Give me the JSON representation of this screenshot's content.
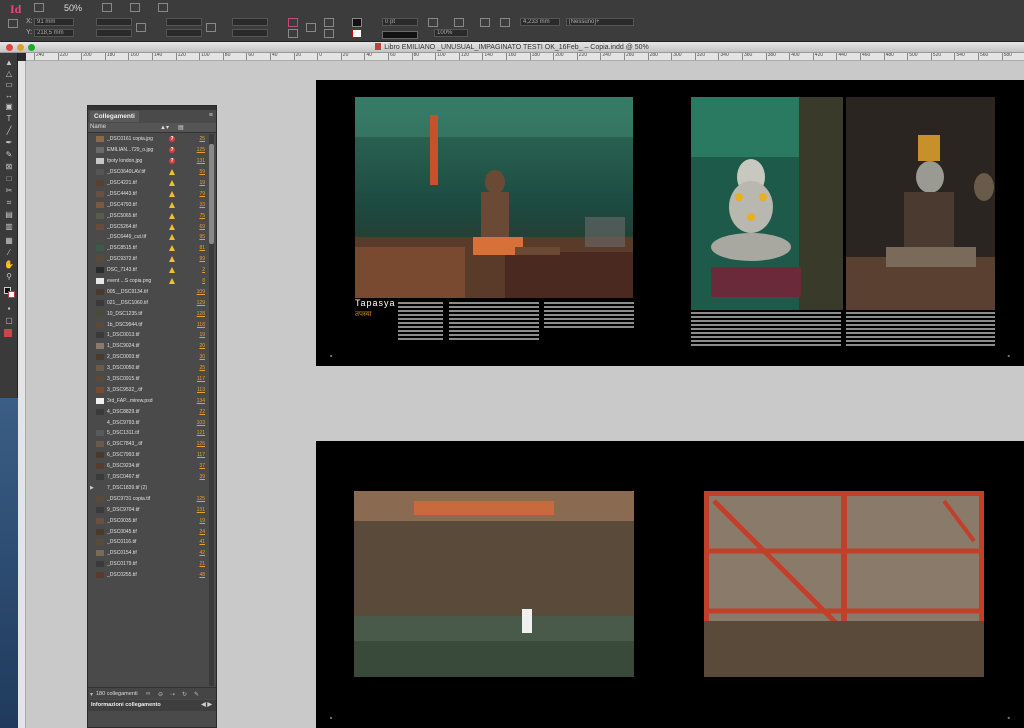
{
  "app": {
    "logo": "Id",
    "zoom": "50%",
    "window_title": "Libro EMILIANO _UNUSUAL_IMPAGINATO TESTI OK_16Feb_ – Copia.indd @ 50%"
  },
  "control_bar": {
    "x_field": "91 mm",
    "y_field": "218,5 mm",
    "stroke_weight": "0 pt",
    "opacity": "100%",
    "gap": "4,233 mm",
    "style_select": "[Nessuno]+"
  },
  "ruler_h_ticks": [
    "240",
    "220",
    "200",
    "180",
    "160",
    "140",
    "120",
    "100",
    "80",
    "60",
    "40",
    "20",
    "0",
    "20",
    "40",
    "60",
    "80",
    "100",
    "120",
    "140",
    "160",
    "180",
    "200",
    "220",
    "240",
    "260",
    "280",
    "300",
    "320",
    "340",
    "360",
    "380",
    "400",
    "420",
    "440",
    "460",
    "480",
    "500",
    "520",
    "540",
    "560",
    "580"
  ],
  "links_panel": {
    "tab_label": "Collegamenti",
    "col_name": "Name",
    "rows": [
      {
        "name": "_DSC0161 copia.jpg",
        "status": "missing",
        "page": "25",
        "thumb": "#8a6a4a"
      },
      {
        "name": "EMILIAN...729_o.jpg",
        "status": "missing",
        "page": "125",
        "thumb": "#6a6a6a"
      },
      {
        "name": "fpoty london.jpg",
        "status": "missing",
        "page": "131",
        "thumb": "#c8c8c8"
      },
      {
        "name": "_DSC0640LAV.tif",
        "status": "warn",
        "page": "59",
        "thumb": "#555"
      },
      {
        "name": "_DSC4221.tif",
        "status": "warn",
        "page": "19",
        "thumb": "#5a4030"
      },
      {
        "name": "_DSC4443.tif",
        "status": "warn",
        "page": "79",
        "thumb": "#6a5040"
      },
      {
        "name": "_DSC4793.tif",
        "status": "warn",
        "page": "33",
        "thumb": "#7a5a3a"
      },
      {
        "name": "_DSC5065.tif",
        "status": "warn",
        "page": "75",
        "thumb": "#5a5a4a"
      },
      {
        "name": "_DSC5264.tif",
        "status": "warn",
        "page": "69",
        "thumb": "#6a4a3a"
      },
      {
        "name": "_DSC6449_cut.tif",
        "status": "warn",
        "page": "95",
        "thumb": "#4a4a4a"
      },
      {
        "name": "_DSC8515.tif",
        "status": "warn",
        "page": "81",
        "thumb": "#3a5a4a"
      },
      {
        "name": "_DSC9372.tif",
        "status": "warn",
        "page": "99",
        "thumb": "#5a4a3a"
      },
      {
        "name": "DSC_7143.tif",
        "status": "warn",
        "page": "2",
        "thumb": "#2a2a2a"
      },
      {
        "name": "event ...S copia.png",
        "status": "warn",
        "page": "8",
        "thumb": "#e8e8e8"
      },
      {
        "name": "005__DSC9134.tif",
        "status": "",
        "page": "109",
        "thumb": "#4a3a2a"
      },
      {
        "name": "021__DSC1060.tif",
        "status": "",
        "page": "129",
        "thumb": "#3a3a3a"
      },
      {
        "name": "10_DSC1235.tif",
        "status": "",
        "page": "128",
        "thumb": "#4a4a3a"
      },
      {
        "name": "1b_DSC9944.tif",
        "status": "",
        "page": "118",
        "thumb": "#5a4a3a"
      },
      {
        "name": "1_DSC0013.tif",
        "status": "",
        "page": "19",
        "thumb": "#3a3a3a"
      },
      {
        "name": "1_DSC9024.tif",
        "status": "",
        "page": "20",
        "thumb": "#8a7a6a"
      },
      {
        "name": "2_DSC0003.tif",
        "status": "",
        "page": "30",
        "thumb": "#4a3a2a"
      },
      {
        "name": "3_DSC0050.tif",
        "status": "",
        "page": "25",
        "thumb": "#6a5a4a"
      },
      {
        "name": "3_DSC0915.tif",
        "status": "",
        "page": "117",
        "thumb": "#5a4a3a"
      },
      {
        "name": "3_DSC9532_.tif",
        "status": "",
        "page": "113",
        "thumb": "#7a4a2a"
      },
      {
        "name": "3rd_FAP...mirew.psd",
        "status": "",
        "page": "134",
        "thumb": "#f0f0f0"
      },
      {
        "name": "4_DSC8829.tif",
        "status": "",
        "page": "22",
        "thumb": "#3a3a3a"
      },
      {
        "name": "4_DSC9793.tif",
        "status": "",
        "page": "103",
        "thumb": "#4a4a4a"
      },
      {
        "name": "5_DSC1311.tif",
        "status": "",
        "page": "121",
        "thumb": "#5a5a5a"
      },
      {
        "name": "6_DSC7843_.tif",
        "status": "",
        "page": "126",
        "thumb": "#6a5a4a"
      },
      {
        "name": "6_DSC7993.tif",
        "status": "",
        "page": "117",
        "thumb": "#4a3a2a"
      },
      {
        "name": "6_DSC9234.tif",
        "status": "",
        "page": "37",
        "thumb": "#5a3a2a"
      },
      {
        "name": "7_DSC0467.tif",
        "status": "",
        "page": "39",
        "thumb": "#3a3a3a"
      },
      {
        "name": "7_DSC1839.tif (2)",
        "status": "",
        "page": "",
        "thumb": "#4a4a4a",
        "group": true
      },
      {
        "name": "_DSC9731 copia.tif",
        "status": "",
        "page": "125",
        "thumb": "#5a4a3a"
      },
      {
        "name": "9_DSC9704.tif",
        "status": "",
        "page": "131",
        "thumb": "#3a3a3a"
      },
      {
        "name": "_DSC0035.tif",
        "status": "",
        "page": "19",
        "thumb": "#6a5040"
      },
      {
        "name": "_DSC0045.tif",
        "status": "",
        "page": "24",
        "thumb": "#4a3a2a"
      },
      {
        "name": "_DSC0116.tif",
        "status": "",
        "page": "41",
        "thumb": "#5a4a3a"
      },
      {
        "name": "_DSC0154.tif",
        "status": "",
        "page": "42",
        "thumb": "#7a6a5a"
      },
      {
        "name": "_DSC0179.tif",
        "status": "",
        "page": "21",
        "thumb": "#3a3a3a"
      },
      {
        "name": "_DSC0255.tif",
        "status": "",
        "page": "48",
        "thumb": "#5a3a2a"
      }
    ],
    "footer_count": "180 collegamenti",
    "info_section": "Informazioni collegamento"
  },
  "spread1": {
    "title": "Tapasya",
    "subtitle": "तपस्या"
  }
}
